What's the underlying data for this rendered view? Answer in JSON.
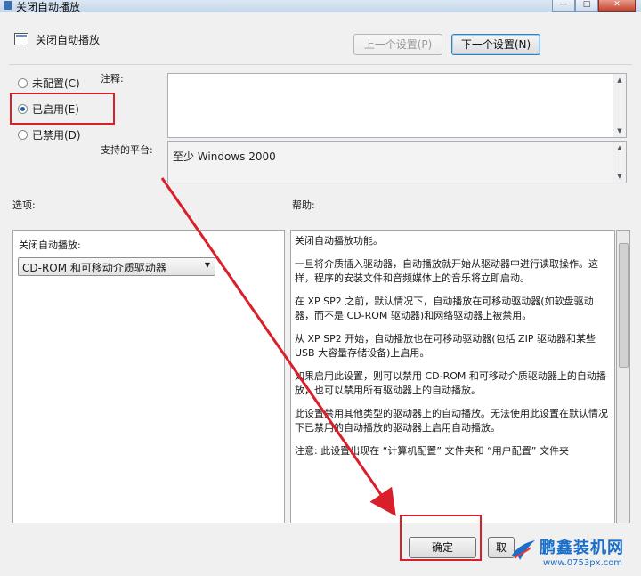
{
  "window": {
    "title": "关闭自动播放",
    "colors": {
      "annotation": "#d9202a",
      "accent": "#3c7fb1"
    }
  },
  "header": {
    "policy_name": "关闭自动播放",
    "prev_label": "上一个设置(P)",
    "next_label": "下一个设置(N)"
  },
  "state": {
    "options": [
      {
        "label": "未配置(C)",
        "selected": false
      },
      {
        "label": "已启用(E)",
        "selected": true
      },
      {
        "label": "已禁用(D)",
        "selected": false
      }
    ]
  },
  "comment": {
    "label": "注释:",
    "value": ""
  },
  "platform": {
    "label": "支持的平台:",
    "value": "至少 Windows 2000"
  },
  "options_section": {
    "label": "选项:",
    "combo_label": "关闭自动播放:",
    "combo_value": "CD-ROM 和可移动介质驱动器"
  },
  "help_section": {
    "label": "帮助:",
    "paragraphs": [
      "关闭自动播放功能。",
      "一旦将介质插入驱动器，自动播放就开始从驱动器中进行读取操作。这样，程序的安装文件和音频媒体上的音乐将立即启动。",
      "在 XP SP2 之前，默认情况下，自动播放在可移动驱动器(如软盘驱动器，而不是 CD-ROM 驱动器)和网络驱动器上被禁用。",
      "从 XP SP2 开始，自动播放也在可移动驱动器(包括 ZIP 驱动器和某些 USB 大容量存储设备)上启用。",
      "如果启用此设置，则可以禁用 CD-ROM 和可移动介质驱动器上的自动播放，也可以禁用所有驱动器上的自动播放。",
      "此设置禁用其他类型的驱动器上的自动播放。无法使用此设置在默认情况下已禁用的自动播放的驱动器上启用自动播放。",
      "注意: 此设置出现在 “计算机配置” 文件夹和 “用户配置” 文件夹"
    ]
  },
  "footer": {
    "ok_label": "确定",
    "cancel_label": "取"
  },
  "watermark": {
    "brand": "鹏鑫装机网",
    "url": "www.0753px.com"
  }
}
